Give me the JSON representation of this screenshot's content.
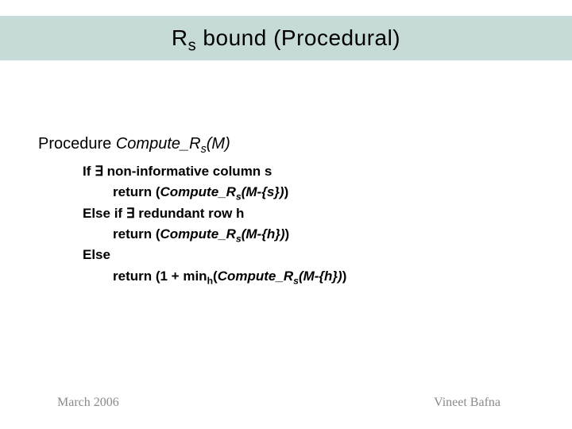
{
  "title": {
    "pre": "R",
    "sub": "s",
    "post": " bound (Procedural)"
  },
  "proc": {
    "lead": "Procedure ",
    "name_pre": "Compute_R",
    "name_sub": "s",
    "name_post": "(M)"
  },
  "lines": {
    "l1": {
      "a": "If ∃ non-informative column s"
    },
    "l2": {
      "a": "return (",
      "b": "Compute_R",
      "sub": "s",
      "c": "(M-{s})",
      "d": ")"
    },
    "l3": {
      "a": "Else if ∃  redundant row h"
    },
    "l4": {
      "a": "return (",
      "b": "Compute_R",
      "sub": "s",
      "c": "(M-{h})",
      "d": ")"
    },
    "l5": {
      "a": "Else"
    },
    "l6": {
      "a": "return (1 + min",
      "sub1": "h",
      "b": "(",
      "c": "Compute_R",
      "sub2": "s",
      "d": "(M-{h})",
      "e": ")"
    }
  },
  "footer": {
    "left": "March 2006",
    "right": "Vineet Bafna"
  }
}
